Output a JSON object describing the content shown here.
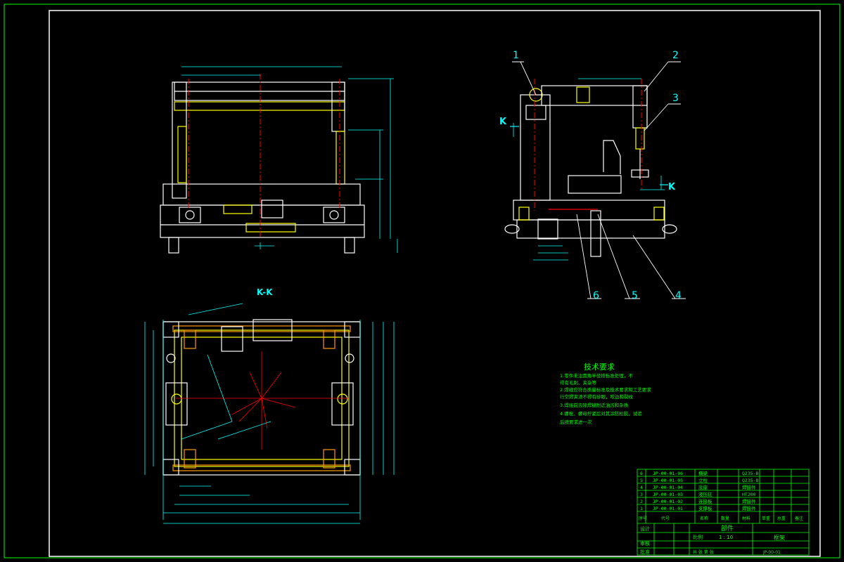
{
  "drawing": {
    "view_label": "K-K",
    "section_letter": "K",
    "balloons": [
      "1",
      "2",
      "3",
      "4",
      "5",
      "6"
    ],
    "tech_title": "技术要求",
    "tech_lines": [
      "1.零件未注圆角半径按标准处理，不",
      "得有毛刺、夹杂等",
      "2.焊缝应符合质量标准及技术要求和工艺要求",
      "行空焊夹渣不得有砂眼，咬边和裂纹",
      "3.焊接前去除焊缝附近油污和杂质",
      "4.螺栓、螺母拧紧后对其涂防松胶，试验",
      "后按要求进一次"
    ],
    "parts": [
      {
        "no": "6",
        "code": "JP-00-01-06",
        "name": "横梁",
        "mat": "Q235-B"
      },
      {
        "no": "5",
        "code": "JP-00-01-05",
        "name": "立柱",
        "mat": "Q235-B"
      },
      {
        "no": "4",
        "code": "JP-00-01-04",
        "name": "底座",
        "mat": "焊接件"
      },
      {
        "no": "3",
        "code": "JP-00-01-03",
        "name": "液压缸",
        "mat": "HT200"
      },
      {
        "no": "2",
        "code": "JP-00-01-02",
        "name": "连接板",
        "mat": "焊接件"
      },
      {
        "no": "1",
        "code": "JP-00-01-01",
        "name": "支撑板",
        "mat": "焊接件"
      }
    ],
    "header_row": [
      "序号",
      "代号",
      "名称",
      "数量",
      "材料",
      "单重",
      "总重",
      "备注"
    ],
    "title_center": "部件",
    "scale_label": "比例",
    "scale_value": "1 : 10",
    "product_name": "框架",
    "drawing_no": "JP-00-01",
    "designer": "设计",
    "checker": "审核",
    "approver": "批准",
    "sheet_text": "共 张 第 张"
  },
  "colors": {
    "background": "#000000",
    "frame": "#ffffff",
    "outline": "#ffffff",
    "yellow": "#ffff00",
    "dimension": "#00ffff",
    "text": "#00ff00",
    "centerline": "#ff0000",
    "magenta": "#ff00ff"
  }
}
